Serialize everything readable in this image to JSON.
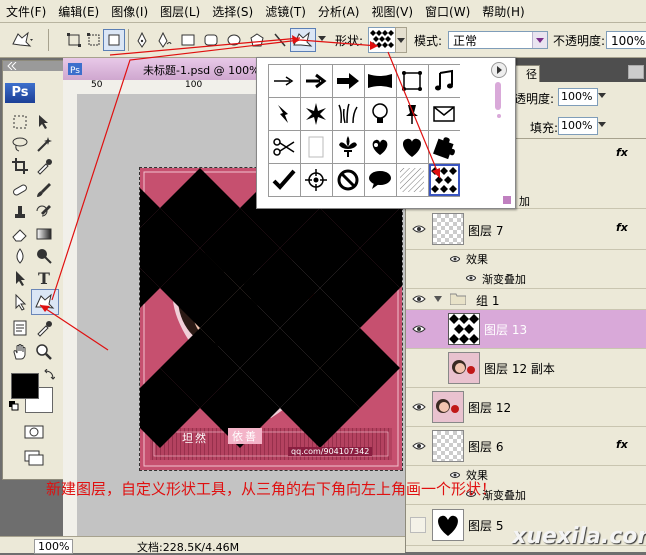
{
  "menu": [
    "文件(F)",
    "编辑(E)",
    "图像(I)",
    "图层(L)",
    "选择(S)",
    "滤镜(T)",
    "分析(A)",
    "视图(V)",
    "窗口(W)",
    "帮助(H)"
  ],
  "options": {
    "shape_label": "形状:",
    "mode_label": "模式:",
    "mode_value": "正常",
    "opacity_label": "不透明度:",
    "opacity_value": "100%"
  },
  "toolbox": {
    "ps_logo": "Ps"
  },
  "document": {
    "tab_title": "未标题-1.psd @ 100%",
    "ruler_marks": [
      "50",
      "100"
    ],
    "art_text_left": "坦然",
    "art_text_right": "依善",
    "art_url": "qq.com/904107342"
  },
  "status": {
    "zoom": "100%",
    "doc_info": "文档:228.5K/4.46M"
  },
  "layers": {
    "tab_label": "径",
    "opacity_label": "透明度:",
    "opacity_value": "100%",
    "fill_label": "填充:",
    "fill_value": "100%",
    "gradient_partial": "加",
    "items": [
      {
        "name": "图层 7",
        "fx": "fx"
      },
      {
        "name": "效果"
      },
      {
        "name": "渐变叠加"
      },
      {
        "name": "组 1"
      },
      {
        "name": "图层 13"
      },
      {
        "name": "图层 12 副本"
      },
      {
        "name": "图层 12"
      },
      {
        "name": "图层 6",
        "fx": "fx"
      },
      {
        "name": "效果"
      },
      {
        "name": "渐变叠加"
      },
      {
        "name": "图层 5"
      }
    ],
    "top_fx": "fx"
  },
  "caption": "新建图层，自定义形状工具，从三角的右下角向左上角画一个形状！",
  "watermark": "xuexila.com",
  "colors": {
    "accent_red": "#e01010",
    "selected_layer": "#d9a9d9",
    "artwork_bg": "#c6506f"
  }
}
